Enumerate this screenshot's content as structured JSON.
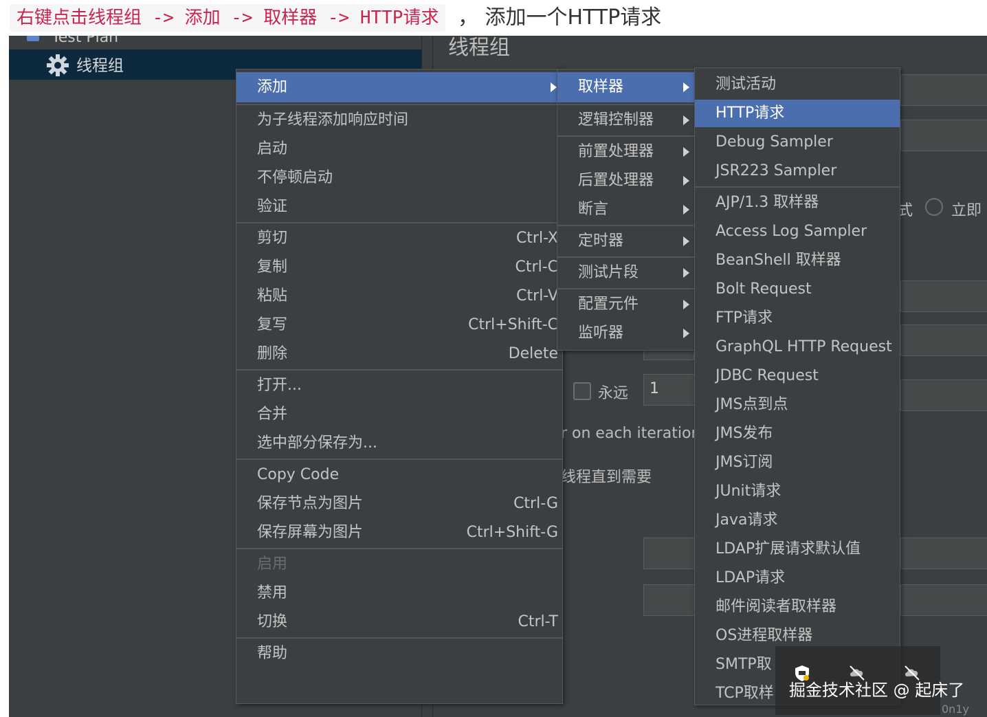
{
  "caption": {
    "code": "右键点击线程组 -> 添加 -> 取样器 -> HTTP请求",
    "rest": "， 添加一个HTTP请求"
  },
  "tree": {
    "root_label": "Test Plan",
    "thread_group_label": "线程组"
  },
  "right_panel": {
    "title": "线程组",
    "forever_label": "永远",
    "loop_value": "1",
    "iteration_text": "r on each iteration",
    "delay_text": "线程直到需要",
    "mode_suffix": "式",
    "immediate_label": "立即"
  },
  "context_menu": {
    "add": "添加",
    "items_group1": [
      "为子线程添加响应时间",
      "启动",
      "不停顿启动",
      "验证"
    ],
    "cut": "剪切",
    "cut_key": "Ctrl-X",
    "copy": "复制",
    "copy_key": "Ctrl-C",
    "paste": "粘贴",
    "paste_key": "Ctrl-V",
    "duplicate": "复写",
    "duplicate_key": "Ctrl+Shift-C",
    "delete": "删除",
    "delete_key": "Delete",
    "open": "打开...",
    "merge": "合并",
    "save_selection": "选中部分保存为...",
    "copy_code": "Copy Code",
    "save_node_image": "保存节点为图片",
    "save_node_image_key": "Ctrl-G",
    "save_screen_image": "保存屏幕为图片",
    "save_screen_image_key": "Ctrl+Shift-G",
    "enable": "启用",
    "disable": "禁用",
    "toggle": "切换",
    "toggle_key": "Ctrl-T",
    "help": "帮助"
  },
  "add_submenu": {
    "sampler": "取样器",
    "logic_controller": "逻辑控制器",
    "pre_processor": "前置处理器",
    "post_processor": "后置处理器",
    "assertion": "断言",
    "timer": "定时器",
    "test_fragment": "测试片段",
    "config_element": "配置元件",
    "listener": "监听器"
  },
  "sampler_submenu": {
    "items": [
      "测试活动",
      "HTTP请求",
      "Debug Sampler",
      "JSR223 Sampler",
      "AJP/1.3 取样器",
      "Access Log Sampler",
      "BeanShell 取样器",
      "Bolt Request",
      "FTP请求",
      "GraphQL HTTP Request",
      "JDBC Request",
      "JMS点到点",
      "JMS发布",
      "JMS订阅",
      "JUnit请求",
      "Java请求",
      "LDAP扩展请求默认值",
      "LDAP请求",
      "邮件阅读者取样器",
      "OS进程取样器",
      "SMTP取",
      "TCP取样"
    ]
  },
  "watermark": {
    "text": "掘金技术社区 @ 起床了",
    "sub": "0n1y"
  },
  "colors": {
    "background": "#3c3f41",
    "selection": "#4b6eaf",
    "tree_selection": "#0d293e",
    "caption_code": "#c7254e"
  }
}
